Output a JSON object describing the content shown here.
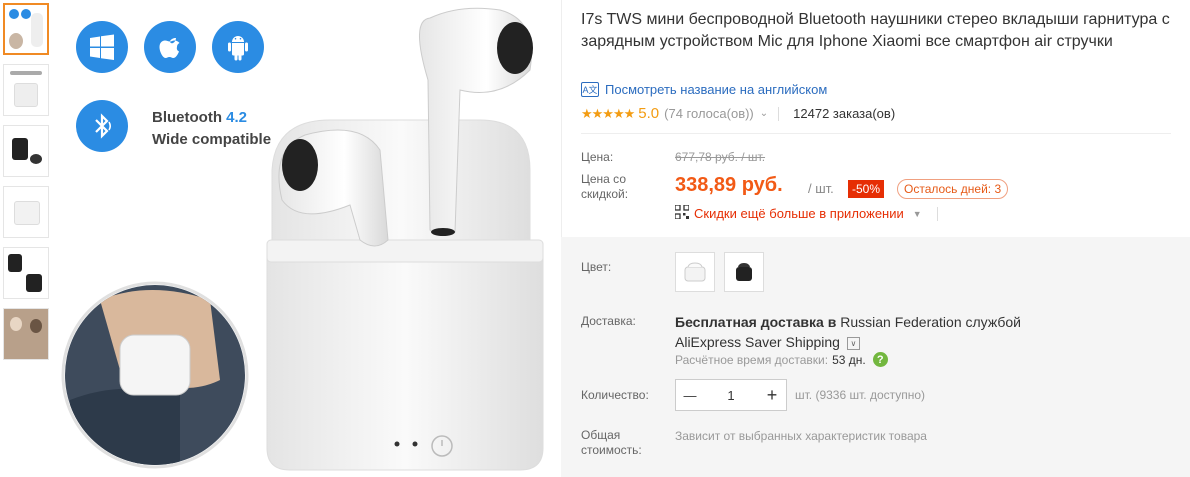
{
  "gallery": {
    "thumb_count": 6,
    "main_text": {
      "bt_label": "Bluetooth",
      "bt_version": "4.2",
      "compat": "Wide compatible"
    }
  },
  "product": {
    "title": "I7s TWS мини беспроводной Bluetooth наушники стерео вкладыши гарнитура с зарядным устройством Mic для Iphone Xiaomi все смартфон air стручки",
    "translate_link": "Посмотреть название на английском",
    "stars": "★★★★★",
    "rating": "5.0",
    "votes": "(74 голоса(ов))",
    "orders": "12472 заказа(ов)"
  },
  "price": {
    "label": "Цена:",
    "old": "677,78 руб. / шт.",
    "discount_label_1": "Цена со",
    "discount_label_2": "скидкой:",
    "new": "338,89 руб.",
    "unit": "/ шт.",
    "discount_badge": "-50%",
    "days_left": "Осталось дней: 3",
    "app_promo": "Скидки ещё больше в приложении"
  },
  "options": {
    "color_label": "Цвет:",
    "colors": [
      "white",
      "black"
    ]
  },
  "shipping": {
    "label": "Доставка:",
    "free": "Бесплатная доставка в",
    "country": "Russian Federation службой",
    "service": "AliExpress Saver Shipping",
    "time_label": "Расчётное время доставки:",
    "time_value": "53 дн.",
    "help": "?"
  },
  "quantity": {
    "label": "Количество:",
    "minus": "—",
    "value": "1",
    "plus": "+",
    "available": "шт. (9336 шт. доступно)"
  },
  "total": {
    "label_1": "Общая",
    "label_2": "стоимость:",
    "value": "Зависит от выбранных характеристик товара"
  },
  "colors": {
    "accent": "#f25a16",
    "link": "#2b6cbf",
    "badge": "#e62e04",
    "star": "#f39c12",
    "icon_blue": "#2b8ce3"
  }
}
